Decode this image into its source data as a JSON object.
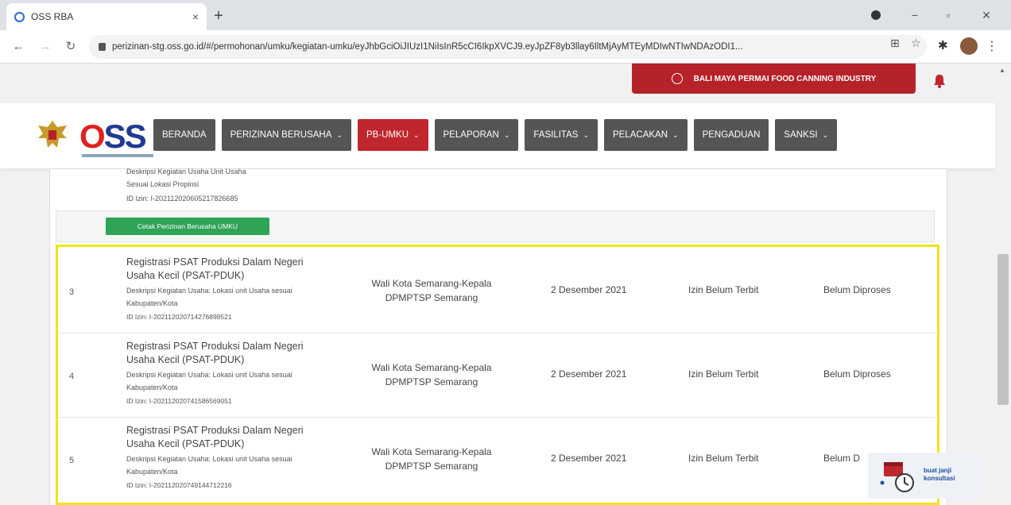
{
  "browser": {
    "tab_title": "OSS RBA",
    "tab_close": "×",
    "new_tab": "+",
    "url": "perizinan-stg.oss.go.id/#/permohonan/umku/kegiatan-umku/eyJhbGciOiJIUzI1NiIsInR5cCI6IkpXVCJ9.eyJpZF8yb3llay6IltMjAyMTEyMDIwNTIwNDAzODI1...",
    "minimize": "−",
    "maximize": "▫",
    "close": "✕"
  },
  "header": {
    "company_name": "BALI MAYA PERMAI FOOD CANNING INDUSTRY"
  },
  "logo": {
    "text_o": "O",
    "text_ss": "SS"
  },
  "menu": [
    {
      "label": "BERANDA",
      "chevron": ""
    },
    {
      "label": "PERIZINAN BERUSAHA",
      "chevron": "⌄"
    },
    {
      "label": "PB-UMKU",
      "chevron": "⌄"
    },
    {
      "label": "PELAPORAN",
      "chevron": "⌄"
    },
    {
      "label": "FASILITAS",
      "chevron": "⌄"
    },
    {
      "label": "PELACAKAN",
      "chevron": "⌄"
    },
    {
      "label": "PENGADUAN",
      "chevron": ""
    },
    {
      "label": "SANKSI",
      "chevron": "⌄"
    }
  ],
  "previous_entry": {
    "desc_line1": "Deskripsi Kegiatan Usaha Unit Usaha",
    "desc_line2": "Sesuai Lokasi Propinsi",
    "id_izin": "ID Izin: I-202112020605217826685",
    "print_button": "Cetak Perizinan Berusaha UMKU"
  },
  "rows": [
    {
      "no": "3",
      "title": "Registrasi PSAT Produksi Dalam Negeri Usaha Kecil (PSAT-PDUK)",
      "desc": "Deskripsi Kegiatan Usaha: Lokasi unit Usaha sesuai Kabupaten/Kota",
      "id_izin": "ID Izin: I-202112020714276898521",
      "instansi": "Wali Kota Semarang-Kepala DPMPTSP Semarang",
      "date": "2 Desember 2021",
      "status": "Izin Belum Terbit",
      "proses": "Belum Diproses"
    },
    {
      "no": "4",
      "title": "Registrasi PSAT Produksi Dalam Negeri Usaha Kecil (PSAT-PDUK)",
      "desc": "Deskripsi Kegiatan Usaha: Lokasi unit Usaha sesuai Kabupaten/Kota",
      "id_izin": "ID Izin: I-202112020741586569051",
      "instansi": "Wali Kota Semarang-Kepala DPMPTSP Semarang",
      "date": "2 Desember 2021",
      "status": "Izin Belum Terbit",
      "proses": "Belum Diproses"
    },
    {
      "no": "5",
      "title": "Registrasi PSAT Produksi Dalam Negeri Usaha Kecil (PSAT-PDUK)",
      "desc": "Deskripsi Kegiatan Usaha: Lokasi unit Usaha sesuai Kabupaten/Kota",
      "id_izin": "ID Izin: I-202112020749144712216",
      "instansi": "Wali Kota Semarang-Kepala DPMPTSP Semarang",
      "date": "2 Desember 2021",
      "status": "Izin Belum Terbit",
      "proses": "Belum D"
    }
  ],
  "consult_widget": {
    "label": "buat janji konsultasi"
  },
  "colors": {
    "brand_red": "#b52228",
    "menu_gray": "#555555",
    "print_green": "#2fa356",
    "highlight_yellow": "#f2e31a"
  }
}
